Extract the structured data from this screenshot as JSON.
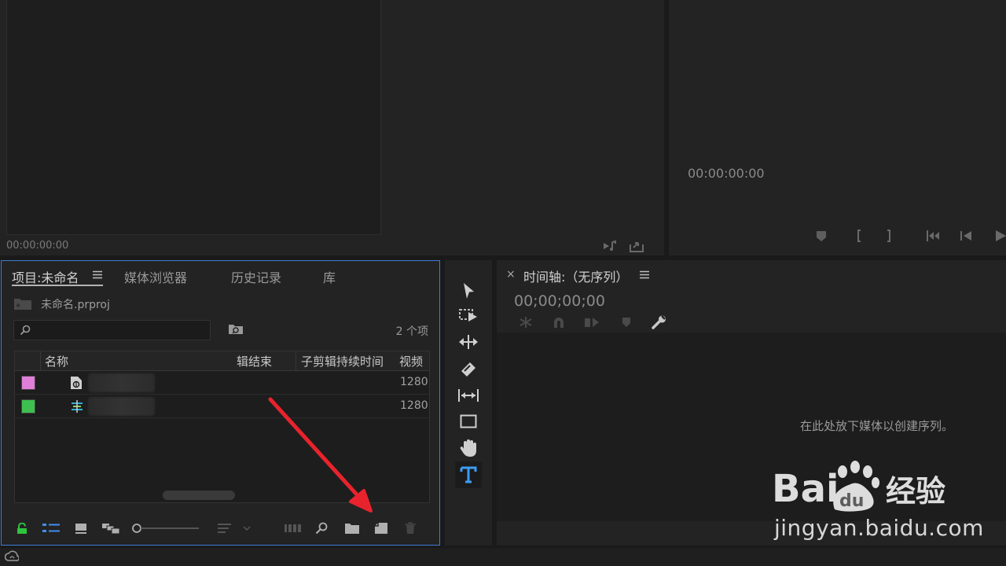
{
  "source_monitor": {
    "timecode": "00:00:00:00"
  },
  "program_monitor": {
    "timecode": "00:00:00:00"
  },
  "project_panel": {
    "tabs": [
      {
        "label": "项目:未命名"
      },
      {
        "label": "媒体浏览器"
      },
      {
        "label": "历史记录"
      },
      {
        "label": "库"
      }
    ],
    "project_file": "未命名.prproj",
    "item_count": "2 个项",
    "columns": {
      "name": "名称",
      "end": "辑结束",
      "subclip_duration": "子剪辑持续时间",
      "video": "视频"
    },
    "rows": [
      {
        "color": "#e07fd8",
        "icon": "adjustment-layer-icon",
        "width": "1280"
      },
      {
        "color": "#3ec050",
        "icon": "sequence-icon",
        "width": "1280"
      }
    ]
  },
  "timeline_panel": {
    "title": "时间轴:（无序列）",
    "timecode": "00;00;00;00",
    "drop_hint": "在此处放下媒体以创建序列。"
  },
  "tools": [
    "selection-tool-icon",
    "track-select-tool-icon",
    "ripple-edit-tool-icon",
    "razor-tool-icon",
    "slip-tool-icon",
    "rectangle-tool-icon",
    "hand-tool-icon",
    "type-tool-icon"
  ],
  "watermark": {
    "brand": "Bai du 经验",
    "url": "jingyan.baidu.com"
  },
  "colors": {
    "accent": "#3f7cd6",
    "arrow": "#e8232d"
  }
}
